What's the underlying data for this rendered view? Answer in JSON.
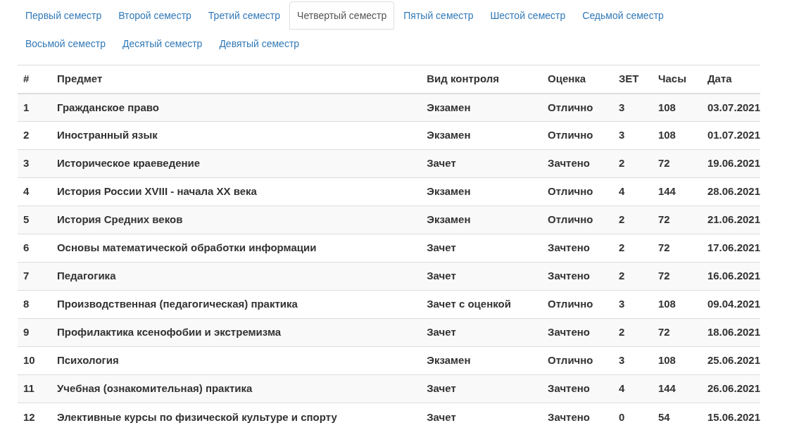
{
  "tabs": [
    {
      "label": "Первый семестр",
      "selected": false
    },
    {
      "label": "Второй семестр",
      "selected": false
    },
    {
      "label": "Третий семестр",
      "selected": false
    },
    {
      "label": "Четвертый семестр",
      "selected": true
    },
    {
      "label": "Пятый семестр",
      "selected": false
    },
    {
      "label": "Шестой семестр",
      "selected": false
    },
    {
      "label": "Седьмой семестр",
      "selected": false
    },
    {
      "label": "Восьмой семестр",
      "selected": false
    },
    {
      "label": "Десятый семестр",
      "selected": false
    },
    {
      "label": "Девятый семестр",
      "selected": false
    }
  ],
  "table": {
    "columns": [
      "#",
      "Предмет",
      "Вид контроля",
      "Оценка",
      "ЗЕТ",
      "Часы",
      "Дата"
    ],
    "rows": [
      [
        "1",
        "Гражданское право",
        "Экзамен",
        "Отлично",
        "3",
        "108",
        "03.07.2021"
      ],
      [
        "2",
        "Иностранный язык",
        "Экзамен",
        "Отлично",
        "3",
        "108",
        "01.07.2021"
      ],
      [
        "3",
        "Историческое краеведение",
        "Зачет",
        "Зачтено",
        "2",
        "72",
        "19.06.2021"
      ],
      [
        "4",
        "История России XVIII - начала XX века",
        "Экзамен",
        "Отлично",
        "4",
        "144",
        "28.06.2021"
      ],
      [
        "5",
        "История Средних веков",
        "Экзамен",
        "Отлично",
        "2",
        "72",
        "21.06.2021"
      ],
      [
        "6",
        "Основы математической обработки информации",
        "Зачет",
        "Зачтено",
        "2",
        "72",
        "17.06.2021"
      ],
      [
        "7",
        "Педагогика",
        "Зачет",
        "Зачтено",
        "2",
        "72",
        "16.06.2021"
      ],
      [
        "8",
        "Производственная (педагогическая) практика",
        "Зачет с оценкой",
        "Отлично",
        "3",
        "108",
        "09.04.2021"
      ],
      [
        "9",
        "Профилактика ксенофобии и экстремизма",
        "Зачет",
        "Зачтено",
        "2",
        "72",
        "18.06.2021"
      ],
      [
        "10",
        "Психология",
        "Экзамен",
        "Отлично",
        "3",
        "108",
        "25.06.2021"
      ],
      [
        "11",
        "Учебная (ознакомительная) практика",
        "Зачет",
        "Зачтено",
        "4",
        "144",
        "26.06.2021"
      ],
      [
        "12",
        "Элективные курсы по физической культуре и спорту",
        "Зачет",
        "Зачтено",
        "0",
        "54",
        "15.06.2021"
      ]
    ]
  }
}
